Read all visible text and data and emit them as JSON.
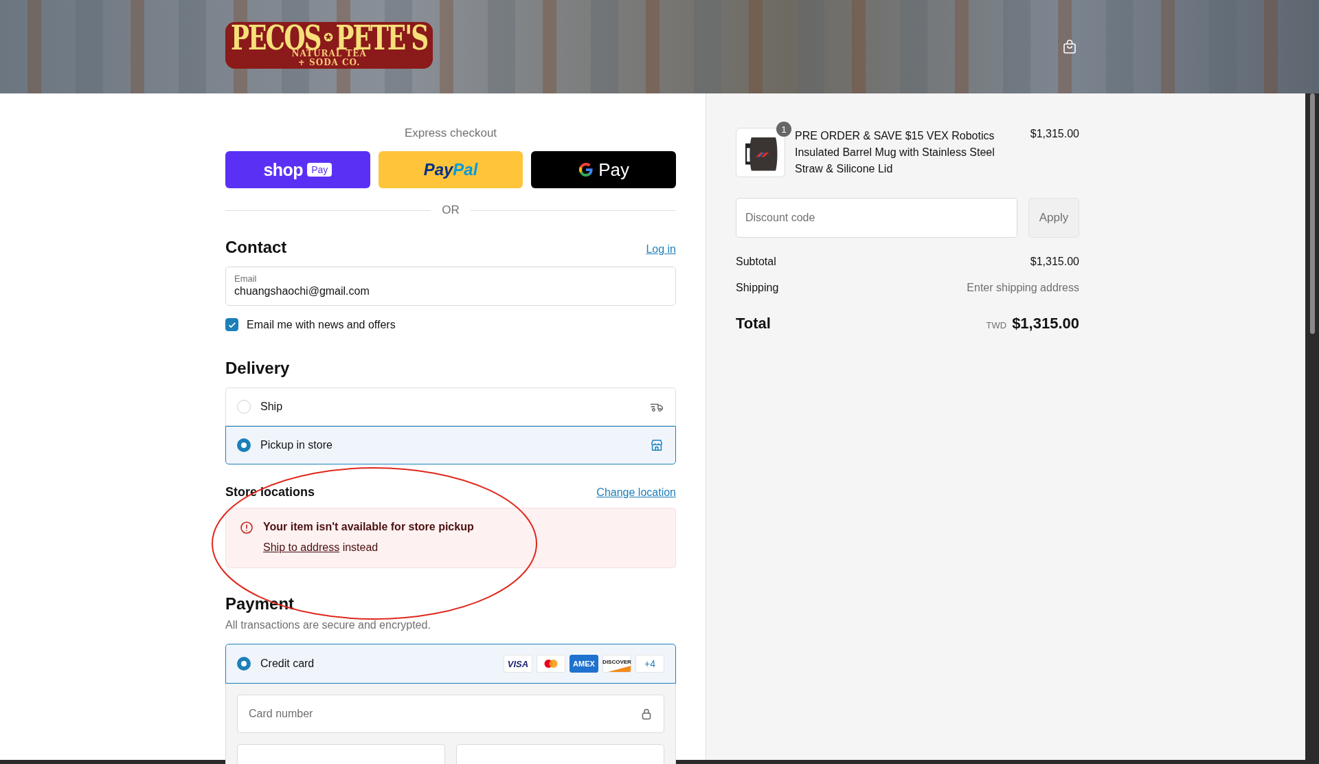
{
  "header": {
    "logo": {
      "word_1": "PECOS",
      "word_2": "PETE'S",
      "tagline_1": "NATURAL TEA",
      "tagline_2": "+ SODA CO."
    }
  },
  "express_checkout": {
    "title": "Express checkout",
    "buttons": [
      {
        "kind": "shop_pay",
        "label": "shop",
        "badge": "Pay"
      },
      {
        "kind": "paypal",
        "label": "Pay",
        "label_2": "Pal"
      },
      {
        "kind": "google_pay",
        "label": "Pay"
      }
    ],
    "divider": "OR"
  },
  "contact": {
    "title": "Contact",
    "login_link": "Log in",
    "email": {
      "label": "Email",
      "value": "chuangshaochi@gmail.com"
    },
    "newsletter": {
      "label": "Email me with news and offers",
      "checked": true
    }
  },
  "delivery": {
    "title": "Delivery",
    "options": [
      {
        "kind": "ship",
        "label": "Ship",
        "selected": false
      },
      {
        "kind": "pickup",
        "label": "Pickup in store",
        "selected": true
      }
    ]
  },
  "store_locations": {
    "title": "Store locations",
    "change_link": "Change location",
    "alert": {
      "message": "Your item isn't available for store pickup",
      "link": "Ship to address",
      "suffix": "instead"
    }
  },
  "payment": {
    "title": "Payment",
    "subtitle": "All transactions are secure and encrypted.",
    "methods": [
      {
        "label": "Credit card",
        "selected": true,
        "cards": [
          {
            "kind": "visa",
            "label": "VISA"
          },
          {
            "kind": "mastercard"
          },
          {
            "kind": "amex",
            "label": "AMEX"
          },
          {
            "kind": "discover",
            "label": "DISCOVER"
          },
          {
            "kind": "more",
            "label": "+4"
          }
        ]
      }
    ],
    "card_number": {
      "placeholder": "Card number"
    }
  },
  "order_summary": {
    "items": [
      {
        "title": "PRE ORDER & SAVE $15 VEX Robotics Insulated Barrel Mug with Stainless Steel Straw & Silicone Lid",
        "price": "$1,315.00",
        "quantity": "1"
      }
    ],
    "discount": {
      "placeholder": "Discount code",
      "button": "Apply"
    },
    "subtotal": {
      "label": "Subtotal",
      "value": "$1,315.00"
    },
    "shipping": {
      "label": "Shipping",
      "value": "Enter shipping address"
    },
    "total": {
      "label": "Total",
      "currency": "TWD",
      "value": "$1,315.00"
    }
  }
}
